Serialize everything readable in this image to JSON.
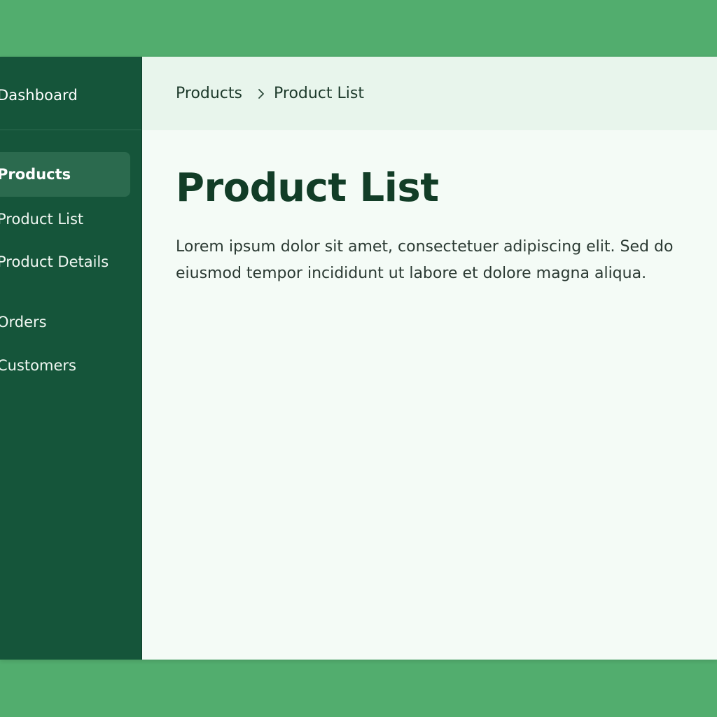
{
  "sidebar": {
    "brand": "Dashboard",
    "items": [
      {
        "label": "Products",
        "active": true
      },
      {
        "label": "Product List"
      },
      {
        "label": "Product Details"
      },
      {
        "label": "Orders"
      },
      {
        "label": "Customers"
      }
    ]
  },
  "breadcrumb": {
    "items": [
      "Products",
      "Product List"
    ],
    "separator_icon": "chevron-right-icon"
  },
  "main": {
    "title": "Product List",
    "description": "Lorem ipsum dolor sit amet, consectetuer adipiscing elit. Sed do eiusmod tempor incididunt ut labore et dolore magna aliqua."
  },
  "colors": {
    "background": "#52ad6e",
    "sidebar": "#15553a",
    "sidebar_active": "#2b6a4e",
    "header": "#e8f5ec",
    "content": "#f4fbf6",
    "title": "#123d27"
  }
}
